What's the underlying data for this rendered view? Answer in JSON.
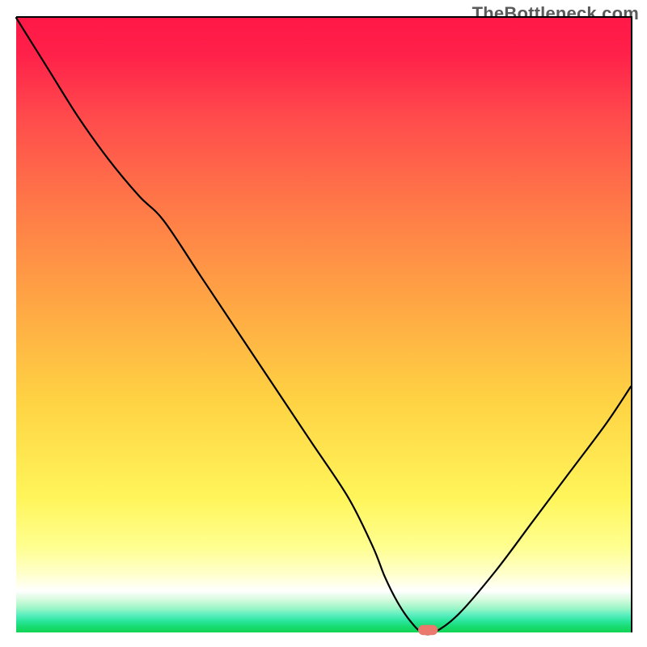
{
  "attribution": "TheBottleneck.com",
  "colors": {
    "gradient_top": "#ff1846",
    "gradient_mid1": "#ff7748",
    "gradient_mid2": "#ffd243",
    "gradient_low": "#ffff8f",
    "gradient_bottom": "#12d455",
    "curve": "#000000",
    "marker": "#e97a6d"
  },
  "chart_data": {
    "type": "line",
    "title": "",
    "xlabel": "",
    "ylabel": "",
    "xlim": [
      0,
      100
    ],
    "ylim": [
      0,
      100
    ],
    "grid": false,
    "legend": false,
    "series": [
      {
        "name": "bottleneck-curve",
        "x": [
          0,
          5,
          10,
          15,
          20,
          24,
          30,
          36,
          42,
          48,
          54,
          58,
          60,
          62,
          64,
          66,
          68,
          72,
          78,
          84,
          90,
          96,
          100
        ],
        "values": [
          100,
          92,
          84,
          77,
          71,
          67,
          58,
          49,
          40,
          31,
          22,
          14,
          9,
          5,
          2,
          0,
          0,
          3,
          10,
          18,
          26,
          34,
          40
        ]
      }
    ],
    "marker": {
      "x": 67,
      "y": 0,
      "shape": "pill"
    }
  }
}
